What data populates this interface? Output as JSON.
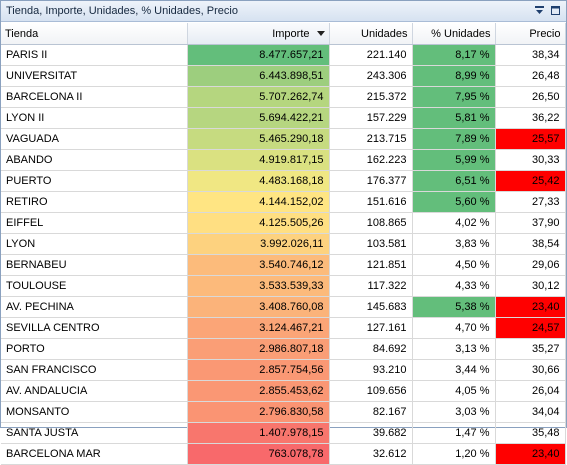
{
  "window": {
    "title": "Tienda, Importe, Unidades, % Unidades, Precio"
  },
  "columns": {
    "tienda": "Tienda",
    "importe": "Importe",
    "unidades": "Unidades",
    "pct": "% Unidades",
    "precio": "Precio"
  },
  "colors": {
    "importe_scale_high": "#63be7b",
    "importe_scale_mid": "#ffeb84",
    "importe_scale_low": "#f8696b",
    "pct_highlight": "#63be7b",
    "precio_alert": "#ff0000"
  },
  "rows": [
    {
      "tienda": "PARIS II",
      "importe": "8.477.657,21",
      "importe_color": "#63be7b",
      "unidades": "221.140",
      "pct": "8,17 %",
      "pct_color": "#63be7b",
      "precio": "38,34",
      "precio_color": ""
    },
    {
      "tienda": "UNIVERSITAT",
      "importe": "6.443.898,51",
      "importe_color": "#9dce7e",
      "unidades": "243.306",
      "pct": "8,99 %",
      "pct_color": "#63be7b",
      "precio": "26,48",
      "precio_color": ""
    },
    {
      "tienda": "BARCELONA II",
      "importe": "5.707.262,74",
      "importe_color": "#b5d67f",
      "unidades": "215.372",
      "pct": "7,95 %",
      "pct_color": "#63be7b",
      "precio": "26,50",
      "precio_color": ""
    },
    {
      "tienda": "LYON II",
      "importe": "5.694.422,21",
      "importe_color": "#b6d680",
      "unidades": "157.229",
      "pct": "5,81 %",
      "pct_color": "#63be7b",
      "precio": "36,22",
      "precio_color": ""
    },
    {
      "tienda": "VAGUADA",
      "importe": "5.465.290,18",
      "importe_color": "#c6db80",
      "unidades": "213.715",
      "pct": "7,89 %",
      "pct_color": "#63be7b",
      "precio": "25,57",
      "precio_color": "#ff0000"
    },
    {
      "tienda": "ABANDO",
      "importe": "4.919.817,15",
      "importe_color": "#dae181",
      "unidades": "162.223",
      "pct": "5,99 %",
      "pct_color": "#63be7b",
      "precio": "30,33",
      "precio_color": ""
    },
    {
      "tienda": "PUERTO",
      "importe": "4.483.168,18",
      "importe_color": "#f0e783",
      "unidades": "176.377",
      "pct": "6,51 %",
      "pct_color": "#63be7b",
      "precio": "25,42",
      "precio_color": "#ff0000"
    },
    {
      "tienda": "RETIRO",
      "importe": "4.144.152,02",
      "importe_color": "#ffe583",
      "unidades": "151.616",
      "pct": "5,60 %",
      "pct_color": "#63be7b",
      "precio": "27,33",
      "precio_color": ""
    },
    {
      "tienda": "EIFFEL",
      "importe": "4.125.505,26",
      "importe_color": "#ffdf82",
      "unidades": "108.865",
      "pct": "4,02 %",
      "pct_color": "",
      "precio": "37,90",
      "precio_color": ""
    },
    {
      "tienda": "LYON",
      "importe": "3.992.026,11",
      "importe_color": "#fdd27f",
      "unidades": "103.581",
      "pct": "3,83 %",
      "pct_color": "",
      "precio": "38,54",
      "precio_color": ""
    },
    {
      "tienda": "BERNABEU",
      "importe": "3.540.746,12",
      "importe_color": "#fcbb7b",
      "unidades": "121.851",
      "pct": "4,50 %",
      "pct_color": "",
      "precio": "29,06",
      "precio_color": ""
    },
    {
      "tienda": "TOULOUSE",
      "importe": "3.533.539,33",
      "importe_color": "#fcba7b",
      "unidades": "117.322",
      "pct": "4,33 %",
      "pct_color": "",
      "precio": "30,12",
      "precio_color": ""
    },
    {
      "tienda": "AV. PECHINA",
      "importe": "3.408.760,08",
      "importe_color": "#fbb37a",
      "unidades": "145.683",
      "pct": "5,38 %",
      "pct_color": "#63be7b",
      "precio": "23,40",
      "precio_color": "#ff0000"
    },
    {
      "tienda": "SEVILLA CENTRO",
      "importe": "3.124.467,21",
      "importe_color": "#fba577",
      "unidades": "127.161",
      "pct": "4,70 %",
      "pct_color": "",
      "precio": "24,57",
      "precio_color": "#ff0000"
    },
    {
      "tienda": "PORTO",
      "importe": "2.986.807,18",
      "importe_color": "#fa9e76",
      "unidades": "84.692",
      "pct": "3,13 %",
      "pct_color": "",
      "precio": "35,27",
      "precio_color": ""
    },
    {
      "tienda": "SAN FRANCISCO",
      "importe": "2.857.754,56",
      "importe_color": "#fa9874",
      "unidades": "93.210",
      "pct": "3,44 %",
      "pct_color": "",
      "precio": "30,66",
      "precio_color": ""
    },
    {
      "tienda": "AV. ANDALUCIA",
      "importe": "2.855.453,62",
      "importe_color": "#fa9774",
      "unidades": "109.656",
      "pct": "4,05 %",
      "pct_color": "",
      "precio": "26,04",
      "precio_color": ""
    },
    {
      "tienda": "MONSANTO",
      "importe": "2.796.830,58",
      "importe_color": "#fa9473",
      "unidades": "82.167",
      "pct": "3,03 %",
      "pct_color": "",
      "precio": "34,04",
      "precio_color": ""
    },
    {
      "tienda": "SANTA JUSTA",
      "importe": "1.407.978,15",
      "importe_color": "#f8766d",
      "unidades": "39.682",
      "pct": "1,47 %",
      "pct_color": "",
      "precio": "35,48",
      "precio_color": ""
    },
    {
      "tienda": "BARCELONA MAR",
      "importe": "763.078,78",
      "importe_color": "#f8696b",
      "unidades": "32.612",
      "pct": "1,20 %",
      "pct_color": "",
      "precio": "23,40",
      "precio_color": "#ff0000"
    }
  ]
}
